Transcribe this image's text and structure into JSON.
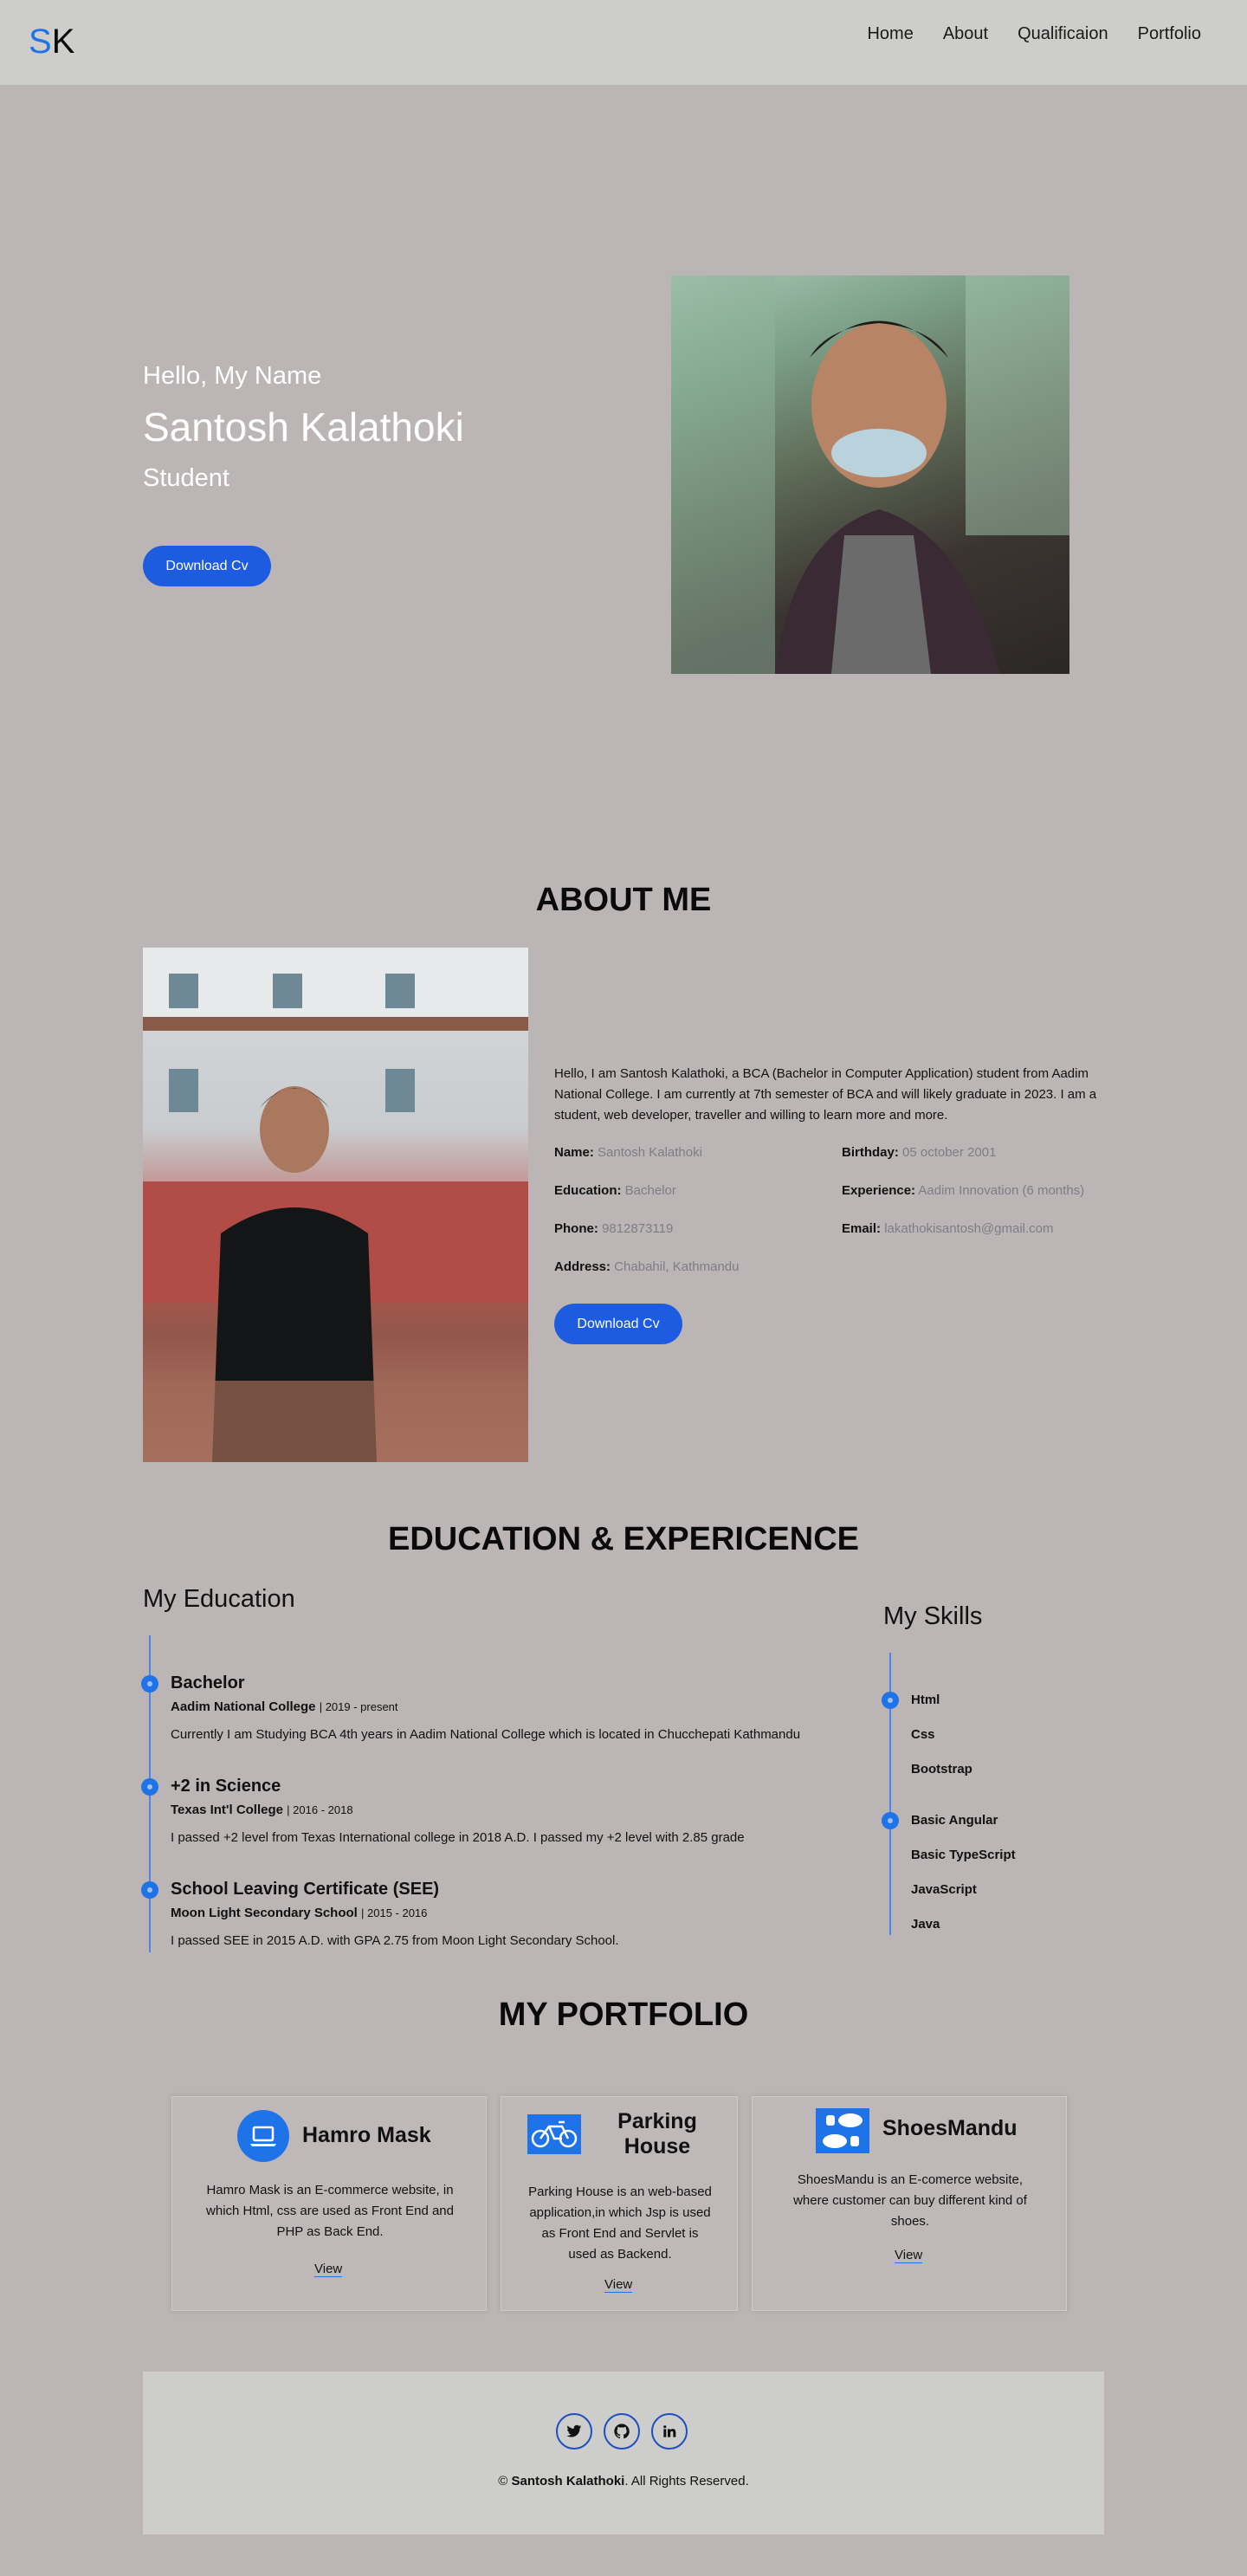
{
  "logo": {
    "first": "S",
    "second": "K"
  },
  "nav": {
    "items": [
      "Home",
      "About",
      "Qualificaion",
      "Portfolio"
    ]
  },
  "hero": {
    "greeting": "Hello, My Name",
    "name": "Santosh Kalathoki",
    "role": "Student",
    "button": "Download Cv"
  },
  "about": {
    "heading": "ABOUT ME",
    "text": "Hello, I am Santosh Kalathoki, a BCA (Bachelor in Computer Application) student from Aadim National College. I am currently at 7th semester of BCA and will likely graduate in 2023. I am a student, web developer, traveller and willing to learn more and more.",
    "info": [
      {
        "label": "Name:",
        "value": "Santosh Kalathoki"
      },
      {
        "label": "Birthday:",
        "value": "05 october 2001"
      },
      {
        "label": "Education:",
        "value": "Bachelor"
      },
      {
        "label": "Experience:",
        "value": "Aadim Innovation (6 months)"
      },
      {
        "label": "Phone:",
        "value": "9812873119"
      },
      {
        "label": "Email:",
        "value": "lakathokisantosh@gmail.com"
      },
      {
        "label": "Address:",
        "value": "Chabahil, Kathmandu"
      }
    ],
    "button": "Download Cv"
  },
  "education": {
    "heading": "EDUCATION & EXPERICENCE",
    "subheading": "My Education",
    "items": [
      {
        "title": "Bachelor",
        "institution": "Aadim National College",
        "years": "| 2019 - present",
        "desc": "Currently I am Studying BCA 4th years in Aadim National College which is located in Chucchepati Kathmandu"
      },
      {
        "title": "+2 in Science",
        "institution": "Texas Int'l College",
        "years": "| 2016 - 2018",
        "desc": "I passed +2 level from Texas International college in 2018 A.D. I passed my +2 level with 2.85 grade"
      },
      {
        "title": "School Leaving Certificate (SEE)",
        "institution": "Moon Light Secondary School",
        "years": "| 2015 - 2016",
        "desc": "I passed SEE in 2015 A.D. with GPA 2.75 from Moon Light Secondary School."
      }
    ]
  },
  "skills": {
    "heading": "My Skills",
    "items": [
      "Html",
      "Css",
      "Bootstrap",
      "Basic Angular",
      "Basic TypeScript",
      "JavaScript",
      "Java"
    ]
  },
  "portfolio": {
    "heading": "MY PORTFOLIO",
    "cards": [
      {
        "title": "Hamro Mask",
        "icon": "laptop-icon",
        "desc": "Hamro Mask is an E-commerce website, in which Html, css are used as Front End and PHP as Back End.",
        "link": "View"
      },
      {
        "title": "Parking House",
        "icon": "bicycle-icon",
        "desc": "Parking House is an web-based application,in which Jsp is used as Front End and Servlet is used as Backend.",
        "link": "View"
      },
      {
        "title": "ShoesMandu",
        "icon": "shoe-prints-icon",
        "desc": "ShoesMandu is an E-comerce website, where customer can buy different kind of shoes.",
        "link": "View"
      }
    ]
  },
  "footer": {
    "social": [
      "twitter-icon",
      "github-icon",
      "linkedin-icon"
    ],
    "copy_prefix": "© ",
    "copy_name": "Santosh Kalathoki",
    "copy_suffix": ". All Rights Reserved."
  },
  "colors": {
    "accent": "#1e73e8",
    "button": "#1d5ce0",
    "background": "#bcb5b5",
    "header": "#cdcdcb"
  }
}
